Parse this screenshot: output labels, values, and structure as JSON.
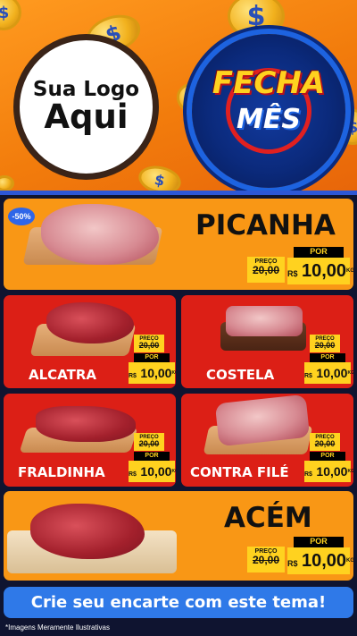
{
  "header": {
    "logo_line1": "Sua Logo",
    "logo_line2": "Aqui",
    "badge_line1": "FECHA",
    "badge_line2": "MÊS",
    "coin_symbol": "$"
  },
  "featured_top": {
    "discount": "-50%",
    "name": "PICANHA",
    "preco_label": "PREÇO",
    "old_price": "20,00",
    "por_label": "POR",
    "currency": "R$",
    "price": "10,00",
    "unit": "KG"
  },
  "grid": [
    {
      "name": "ALCATRA",
      "preco_label": "PREÇO",
      "old_price": "20,00",
      "por_label": "POR",
      "currency": "R$",
      "price": "10,00",
      "unit": "KG"
    },
    {
      "name": "COSTELA",
      "preco_label": "PREÇO",
      "old_price": "20,00",
      "por_label": "POR",
      "currency": "R$",
      "price": "10,00",
      "unit": "KG"
    },
    {
      "name": "FRALDINHA",
      "preco_label": "PREÇO",
      "old_price": "20,00",
      "por_label": "POR",
      "currency": "R$",
      "price": "10,00",
      "unit": "KG"
    },
    {
      "name": "CONTRA FILÉ",
      "preco_label": "PREÇO",
      "old_price": "20,00",
      "por_label": "POR",
      "currency": "R$",
      "price": "10,00",
      "unit": "KG"
    }
  ],
  "featured_bottom": {
    "name": "ACÉM",
    "preco_label": "PREÇO",
    "old_price": "20,00",
    "por_label": "POR",
    "currency": "R$",
    "price": "10,00",
    "unit": "KG"
  },
  "cta": "Crie seu encarte com este tema!",
  "footnote": "*Imagens Meramente Ilustrativas",
  "colors": {
    "orange": "#f99715",
    "red": "#dc1f16",
    "yellow": "#ffd21f",
    "blue": "#2f79e8",
    "dark": "#0f1430"
  }
}
